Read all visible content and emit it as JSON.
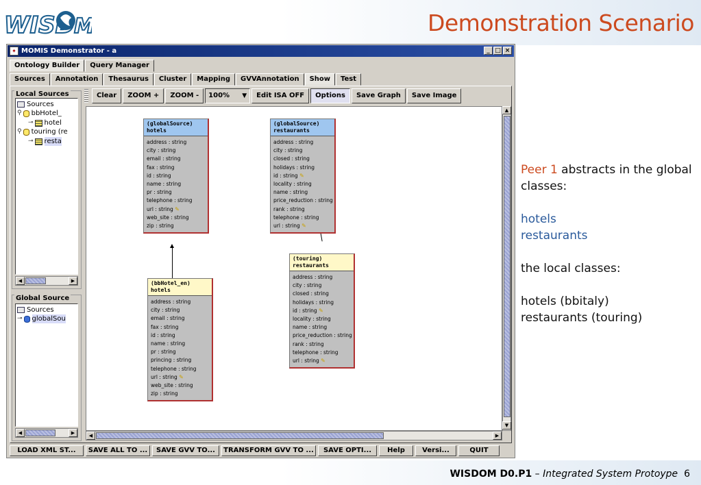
{
  "slide": {
    "title": "Demonstration Scenario",
    "logo_text": "WISDOM",
    "footer_bold": "WISDOM D0.P1",
    "footer_dash": " – ",
    "footer_italic": "Integrated System Protoype",
    "page_number": "6"
  },
  "notes": {
    "peer_label": "Peer 1",
    "line1_rest": " abstracts in the global classes:",
    "global_classes": [
      "hotels",
      "restaurants"
    ],
    "local_heading": "the local classes:",
    "local_classes": [
      "hotels (bbitaly)",
      "restaurants (touring)"
    ]
  },
  "window": {
    "title": "MOMIS Demonstrator - a",
    "minimize": "_",
    "maximize": "□",
    "close": "×"
  },
  "main_tabs": [
    "Ontology Builder",
    "Query Manager"
  ],
  "sub_tabs": [
    "Sources",
    "Annotation",
    "Thesaurus",
    "Cluster",
    "Mapping",
    "GVVAnnotation",
    "Show",
    "Test"
  ],
  "local_sources": {
    "title": "Local Sources",
    "root": "Sources",
    "items": [
      "bbHotel_",
      "hotel",
      "touring (re",
      "resta"
    ]
  },
  "global_source": {
    "title": "Global Source",
    "root": "Sources",
    "item": "globalSou"
  },
  "toolbar": {
    "clear": "Clear",
    "zoom_in": "ZOOM +",
    "zoom_out": "ZOOM -",
    "zoom_level": "100%",
    "edit_isa": "Edit ISA OFF",
    "options": "Options",
    "save_graph": "Save Graph",
    "save_image": "Save Image"
  },
  "classes": [
    {
      "source": "(globalSource)",
      "name": "hotels",
      "kind": "global",
      "attributes": [
        "address : string",
        "city : string",
        "email : string",
        "fax : string",
        "id : string",
        "name : string",
        "pr : string",
        "telephone : string",
        "url : string",
        "web_site : string",
        "zip : string"
      ],
      "key_attr_index": 8
    },
    {
      "source": "(globalSource)",
      "name": "restaurants",
      "kind": "global",
      "attributes": [
        "address : string",
        "city : string",
        "closed : string",
        "holidays : string",
        "id : string",
        "locality : string",
        "name : string",
        "price_reduction : string",
        "rank : string",
        "telephone : string",
        "url : string"
      ],
      "key_attr_index": 4,
      "key_attr_index2": 10
    },
    {
      "source": "(bbHotel_en)",
      "name": "hotels",
      "kind": "local",
      "attributes": [
        "address : string",
        "city : string",
        "email : string",
        "fax : string",
        "id : string",
        "name : string",
        "pr : string",
        "princing : string",
        "telephone : string",
        "url : string",
        "web_site : string",
        "zip : string"
      ],
      "key_attr_index": 9
    },
    {
      "source": "(touring)",
      "name": "restaurants",
      "kind": "local",
      "attributes": [
        "address : string",
        "city : string",
        "closed : string",
        "holidays : string",
        "id : string",
        "locality : string",
        "name : string",
        "price_reduction : string",
        "rank : string",
        "telephone : string",
        "url : string"
      ],
      "key_attr_index": 4,
      "key_attr_index2": 10
    }
  ],
  "key_glyph": "✎",
  "scroll_glyphs": {
    "left": "◀",
    "right": "▶",
    "up": "▲",
    "down": "▼"
  },
  "bottom_buttons": [
    "LOAD XML ST...",
    "SAVE ALL TO ...",
    "SAVE GVV TO...",
    "TRANSFORM GVV TO ...",
    "SAVE OPTI...",
    "Help",
    "Versi...",
    "QUIT"
  ],
  "colors": {
    "title_orange": "#cc4a1f",
    "note_blue": "#2a5a9b",
    "global_header": "#9fc6ef",
    "local_header": "#fff8c8",
    "window_title_bar": "#0a246a"
  }
}
